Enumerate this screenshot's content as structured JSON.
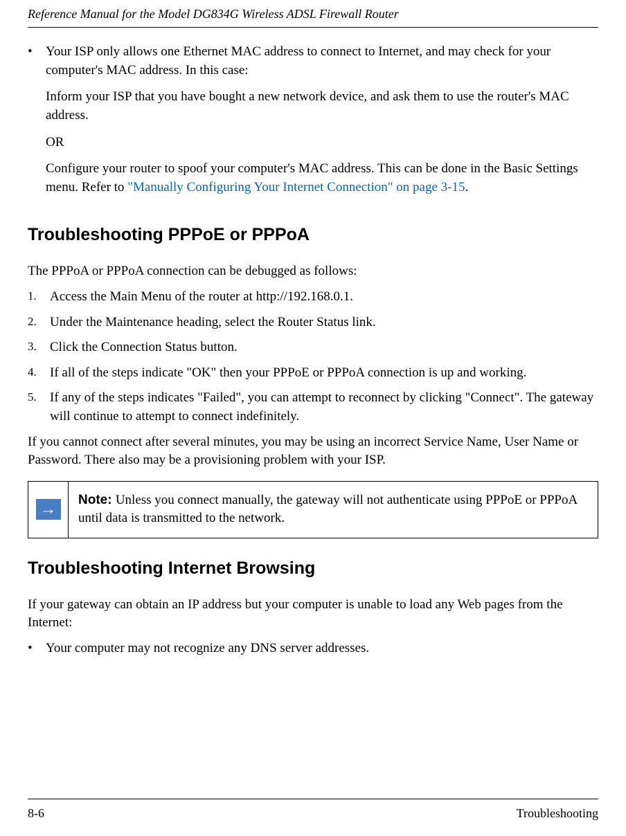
{
  "header": {
    "title": "Reference Manual for the Model DG834G Wireless ADSL Firewall Router"
  },
  "intro_bullet": {
    "lead": "Your ISP only allows one Ethernet MAC address to connect to Internet, and may check for your computer's MAC address. In this case:",
    "p1": "Inform your ISP that you have bought a new network device, and ask them to use the router's MAC address.",
    "p2": "OR",
    "p3_a": "Configure your router to spoof your computer's MAC address. This can be done in the Basic Settings menu. Refer to ",
    "p3_link": "\"Manually Configuring Your Internet Connection\" on page 3-15",
    "p3_b": "."
  },
  "section1": {
    "heading": "Troubleshooting PPPoE or PPPoA",
    "intro": "The PPPoA or PPPoA connection can be debugged as follows:",
    "steps": [
      "Access the Main Menu of the router at http://192.168.0.1.",
      "Under the Maintenance heading, select the Router Status link.",
      "Click the Connection Status button.",
      "If all of the steps indicate \"OK\" then your PPPoE or PPPoA connection is up and working.",
      "If any of the steps indicates \"Failed\", you can attempt to reconnect by clicking \"Connect\". The gateway will continue to attempt to connect indefinitely."
    ],
    "after": "If you cannot connect after several minutes, you may be using an incorrect Service Name, User Name or Password. There also may be a provisioning problem with your ISP."
  },
  "note": {
    "label": "Note: ",
    "text": "Unless you connect manually, the gateway will not authenticate using PPPoE or PPPoA until data is transmitted to the network."
  },
  "section2": {
    "heading": "Troubleshooting Internet Browsing",
    "intro": "If your gateway can obtain an IP address but your computer is unable to load any Web pages from the Internet:",
    "bullet": "Your computer may not recognize any DNS server addresses."
  },
  "footer": {
    "page": "8-6",
    "chapter": "Troubleshooting"
  }
}
